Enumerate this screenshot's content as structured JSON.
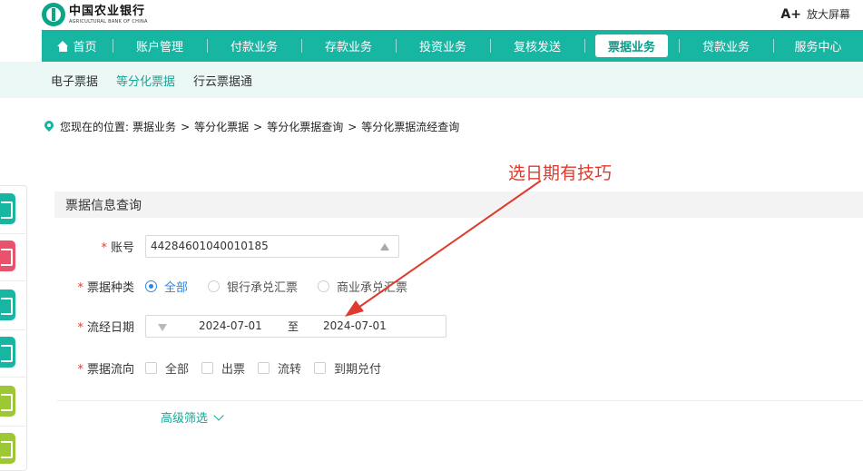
{
  "header": {
    "bank_name_cn": "中国农业银行",
    "bank_name_en": "AGRICULTURAL BANK OF CHINA",
    "zoom_symbol": "A+",
    "zoom_label": "放大屏幕"
  },
  "nav": {
    "items": [
      {
        "label": "首页",
        "icon": "home-icon"
      },
      {
        "label": "账户管理"
      },
      {
        "label": "付款业务"
      },
      {
        "label": "存款业务"
      },
      {
        "label": "投资业务"
      },
      {
        "label": "复核发送"
      },
      {
        "label": "票据业务",
        "active": true
      },
      {
        "label": "贷款业务"
      },
      {
        "label": "服务中心"
      }
    ]
  },
  "subnav": {
    "items": [
      {
        "label": "电子票据"
      },
      {
        "label": "等分化票据",
        "active": true
      },
      {
        "label": "行云票据通"
      }
    ]
  },
  "breadcrumb": {
    "prefix": "您现在的位置:",
    "items": [
      "票据业务",
      "等分化票据",
      "等分化票据查询",
      "等分化票据流经查询"
    ],
    "separator": ">"
  },
  "annotation": {
    "text": "选日期有技巧"
  },
  "card": {
    "title": "票据信息查询"
  },
  "form": {
    "account": {
      "label": "账号",
      "value": "44284601040010185"
    },
    "bill_type": {
      "label": "票据种类",
      "options": [
        "全部",
        "银行承兑汇票",
        "商业承兑汇票"
      ],
      "selected": "全部"
    },
    "flow_date": {
      "label": "流经日期",
      "start": "2024-07-01",
      "to": "至",
      "end": "2024-07-01"
    },
    "flow_direction": {
      "label": "票据流向",
      "options": [
        "全部",
        "出票",
        "流转",
        "到期兑付"
      ]
    },
    "required_mark": "*"
  },
  "advanced_filter": {
    "label": "高级筛选"
  },
  "colors": {
    "brand": "#16b6a3",
    "accent_text": "#16a897",
    "annotation": "#e03a2e",
    "radio_checked": "#2b86e3",
    "required": "#e33d2f"
  },
  "side_icons": [
    {
      "name": "search-doc-icon",
      "color": "#16b6a3"
    },
    {
      "name": "document-stack-icon",
      "color": "#e9516c"
    },
    {
      "name": "card-icon",
      "color": "#16b6a3"
    },
    {
      "name": "calculator-icon",
      "color": "#16b6a3"
    },
    {
      "name": "receipt-icon",
      "color": "#9cc835"
    },
    {
      "name": "report-icon",
      "color": "#9cc835"
    }
  ]
}
